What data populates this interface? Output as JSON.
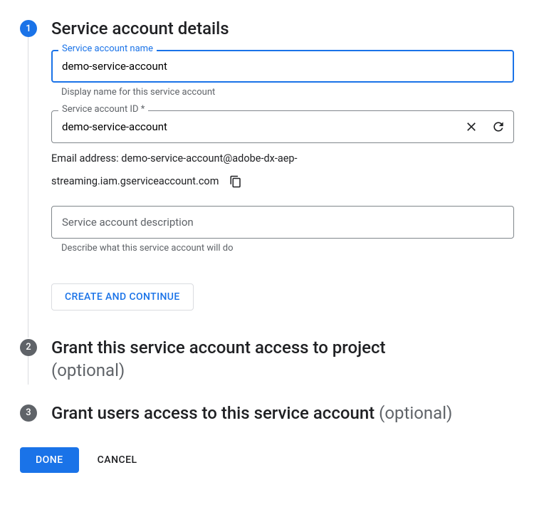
{
  "steps": {
    "s1": {
      "number": "1",
      "title": "Service account details"
    },
    "s2": {
      "number": "2",
      "title": "Grant this service account access to project",
      "optional": "(optional)"
    },
    "s3": {
      "number": "3",
      "title": "Grant users access to this service account",
      "optional": "(optional)"
    }
  },
  "fields": {
    "name": {
      "label": "Service account name",
      "value": "demo-service-account",
      "helper": "Display name for this service account"
    },
    "id": {
      "label": "Service account ID *",
      "value": "demo-service-account"
    },
    "email": {
      "prefix": "Email address: ",
      "line1": "demo-service-account@adobe-dx-aep-",
      "line2": "streaming.iam.gserviceaccount.com"
    },
    "description": {
      "placeholder": "Service account description",
      "helper": "Describe what this service account will do"
    }
  },
  "buttons": {
    "create_continue": "CREATE AND CONTINUE",
    "done": "DONE",
    "cancel": "CANCEL"
  }
}
